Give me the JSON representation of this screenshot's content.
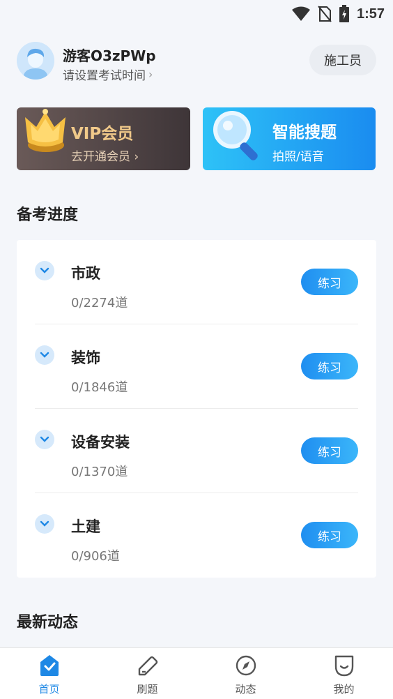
{
  "status_bar": {
    "time": "1:57"
  },
  "header": {
    "user_name": "游客O3zPWp",
    "exam_time_prompt": "请设置考试时间",
    "chevron": "›",
    "role_button": "施工员"
  },
  "promos": {
    "vip": {
      "title": "VIP会员",
      "subtitle": "去开通会员 ›"
    },
    "search": {
      "title": "智能搜题",
      "subtitle": "拍照/语音"
    }
  },
  "progress": {
    "title": "备考进度",
    "practice_label": "练习",
    "subjects": [
      {
        "name": "市政",
        "count": "0/2274道"
      },
      {
        "name": "装饰",
        "count": "0/1846道"
      },
      {
        "name": "设备安装",
        "count": "0/1370道"
      },
      {
        "name": "土建",
        "count": "0/906道"
      }
    ]
  },
  "news": {
    "title": "最新动态"
  },
  "nav": {
    "items": [
      {
        "label": "首页",
        "icon": "home-icon"
      },
      {
        "label": "刷题",
        "icon": "edit-icon"
      },
      {
        "label": "动态",
        "icon": "compass-icon"
      },
      {
        "label": "我的",
        "icon": "profile-icon"
      }
    ]
  },
  "colors": {
    "accent": "#1e88e5",
    "vip_gold": "#f0c98a",
    "background": "#f4f6fa"
  }
}
